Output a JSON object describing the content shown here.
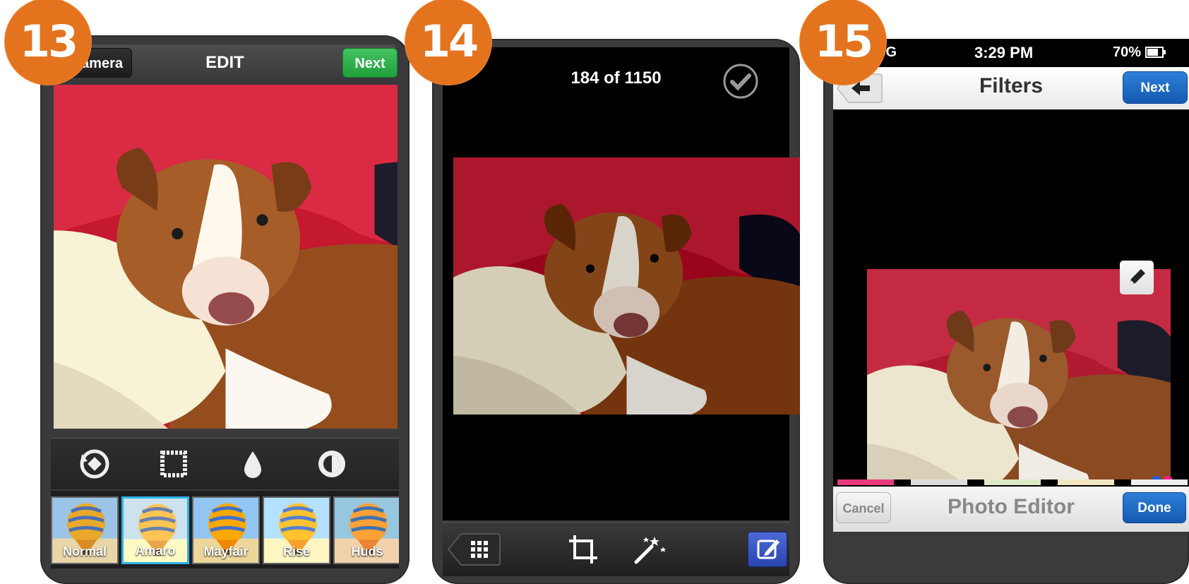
{
  "steps": [
    "13",
    "14",
    "15"
  ],
  "screen13": {
    "camera_label": "Camera",
    "title": "EDIT",
    "next_label": "Next",
    "tools": [
      "rotate-icon",
      "frame-icon",
      "tilt-shift-icon",
      "lux-icon"
    ],
    "filters": [
      {
        "label": "Normal",
        "selected": false
      },
      {
        "label": "Amaro",
        "selected": true
      },
      {
        "label": "Mayfair",
        "selected": false
      },
      {
        "label": "Rise",
        "selected": false
      },
      {
        "label": "Huds",
        "selected": false
      }
    ],
    "accent_next": "#2eaa4a",
    "accent_selected": "#2db3e8"
  },
  "screen14": {
    "counter": "184 of 1150",
    "icons": [
      "checkmark-icon",
      "grid-icon",
      "crop-icon",
      "magic-wand-icon",
      "edit-icon"
    ],
    "accent_edit": "#3a57c4"
  },
  "screen15": {
    "status": {
      "carrier": "Sprint 3G",
      "time": "3:29 PM",
      "battery": "70%"
    },
    "title": "Filters",
    "next_label": "Next",
    "bottom_title": "Photo Editor",
    "cancel_label": "Cancel",
    "done_label": "Done",
    "accent_blue": "#1f6cc7",
    "flickr_colors": [
      "#1e5fd6",
      "#ff1a8c"
    ]
  }
}
